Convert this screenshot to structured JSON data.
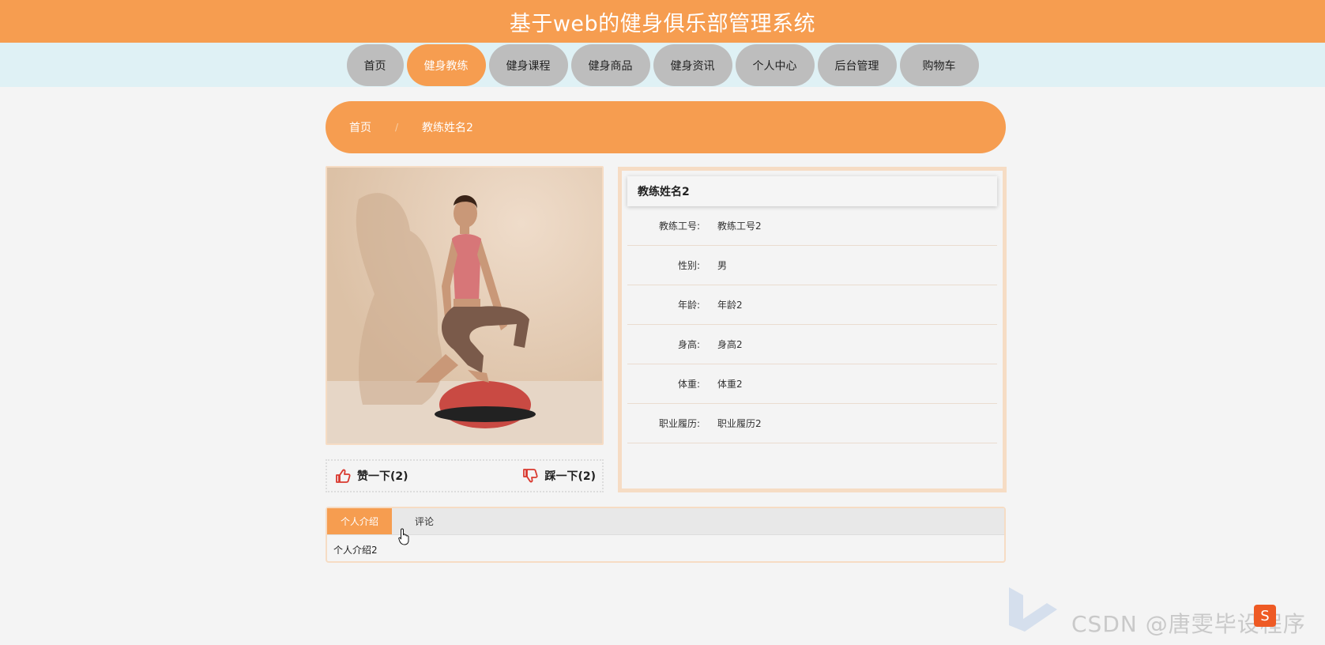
{
  "site_title": "基于web的健身俱乐部管理系统",
  "nav": [
    {
      "label": "首页",
      "active": false
    },
    {
      "label": "健身教练",
      "active": true
    },
    {
      "label": "健身课程",
      "active": false
    },
    {
      "label": "健身商品",
      "active": false
    },
    {
      "label": "健身资讯",
      "active": false
    },
    {
      "label": "个人中心",
      "active": false
    },
    {
      "label": "后台管理",
      "active": false
    },
    {
      "label": "购物车",
      "active": false
    }
  ],
  "breadcrumb": {
    "home": "首页",
    "separator": "/",
    "current": "教练姓名2"
  },
  "votes": {
    "like_label": "赞一下(2)",
    "dislike_label": "踩一下(2)"
  },
  "detail": {
    "name": "教练姓名2",
    "rows": [
      {
        "label": "教练工号:",
        "value": "教练工号2"
      },
      {
        "label": "性别:",
        "value": "男"
      },
      {
        "label": "年龄:",
        "value": "年龄2"
      },
      {
        "label": "身高:",
        "value": "身高2"
      },
      {
        "label": "体重:",
        "value": "体重2"
      },
      {
        "label": "职业履历:",
        "value": "职业履历2"
      }
    ]
  },
  "tabs": {
    "items": [
      {
        "label": "个人介绍",
        "active": true
      },
      {
        "label": "评论",
        "active": false
      }
    ],
    "content": "个人介绍2"
  },
  "watermark": {
    "text": "CSDN @唐雯毕设程序",
    "badge": "S"
  },
  "colors": {
    "accent": "#f69d50",
    "nav_bg": "#dff1f5",
    "nav_inactive": "#bdbdbd",
    "card_border": "#f6dcc4"
  }
}
